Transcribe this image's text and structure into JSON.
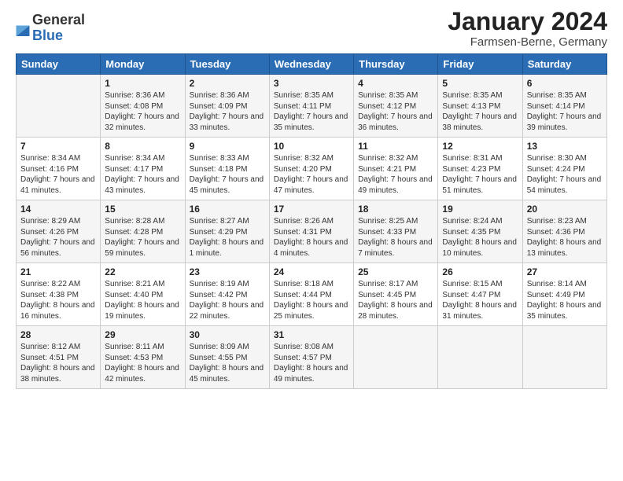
{
  "header": {
    "logo": {
      "general": "General",
      "blue": "Blue"
    },
    "title": "January 2024",
    "subtitle": "Farmsen-Berne, Germany"
  },
  "days_of_week": [
    "Sunday",
    "Monday",
    "Tuesday",
    "Wednesday",
    "Thursday",
    "Friday",
    "Saturday"
  ],
  "weeks": [
    [
      {
        "day": "",
        "sunrise": "",
        "sunset": "",
        "daylight": ""
      },
      {
        "day": "1",
        "sunrise": "Sunrise: 8:36 AM",
        "sunset": "Sunset: 4:08 PM",
        "daylight": "Daylight: 7 hours and 32 minutes."
      },
      {
        "day": "2",
        "sunrise": "Sunrise: 8:36 AM",
        "sunset": "Sunset: 4:09 PM",
        "daylight": "Daylight: 7 hours and 33 minutes."
      },
      {
        "day": "3",
        "sunrise": "Sunrise: 8:35 AM",
        "sunset": "Sunset: 4:11 PM",
        "daylight": "Daylight: 7 hours and 35 minutes."
      },
      {
        "day": "4",
        "sunrise": "Sunrise: 8:35 AM",
        "sunset": "Sunset: 4:12 PM",
        "daylight": "Daylight: 7 hours and 36 minutes."
      },
      {
        "day": "5",
        "sunrise": "Sunrise: 8:35 AM",
        "sunset": "Sunset: 4:13 PM",
        "daylight": "Daylight: 7 hours and 38 minutes."
      },
      {
        "day": "6",
        "sunrise": "Sunrise: 8:35 AM",
        "sunset": "Sunset: 4:14 PM",
        "daylight": "Daylight: 7 hours and 39 minutes."
      }
    ],
    [
      {
        "day": "7",
        "sunrise": "Sunrise: 8:34 AM",
        "sunset": "Sunset: 4:16 PM",
        "daylight": "Daylight: 7 hours and 41 minutes."
      },
      {
        "day": "8",
        "sunrise": "Sunrise: 8:34 AM",
        "sunset": "Sunset: 4:17 PM",
        "daylight": "Daylight: 7 hours and 43 minutes."
      },
      {
        "day": "9",
        "sunrise": "Sunrise: 8:33 AM",
        "sunset": "Sunset: 4:18 PM",
        "daylight": "Daylight: 7 hours and 45 minutes."
      },
      {
        "day": "10",
        "sunrise": "Sunrise: 8:32 AM",
        "sunset": "Sunset: 4:20 PM",
        "daylight": "Daylight: 7 hours and 47 minutes."
      },
      {
        "day": "11",
        "sunrise": "Sunrise: 8:32 AM",
        "sunset": "Sunset: 4:21 PM",
        "daylight": "Daylight: 7 hours and 49 minutes."
      },
      {
        "day": "12",
        "sunrise": "Sunrise: 8:31 AM",
        "sunset": "Sunset: 4:23 PM",
        "daylight": "Daylight: 7 hours and 51 minutes."
      },
      {
        "day": "13",
        "sunrise": "Sunrise: 8:30 AM",
        "sunset": "Sunset: 4:24 PM",
        "daylight": "Daylight: 7 hours and 54 minutes."
      }
    ],
    [
      {
        "day": "14",
        "sunrise": "Sunrise: 8:29 AM",
        "sunset": "Sunset: 4:26 PM",
        "daylight": "Daylight: 7 hours and 56 minutes."
      },
      {
        "day": "15",
        "sunrise": "Sunrise: 8:28 AM",
        "sunset": "Sunset: 4:28 PM",
        "daylight": "Daylight: 7 hours and 59 minutes."
      },
      {
        "day": "16",
        "sunrise": "Sunrise: 8:27 AM",
        "sunset": "Sunset: 4:29 PM",
        "daylight": "Daylight: 8 hours and 1 minute."
      },
      {
        "day": "17",
        "sunrise": "Sunrise: 8:26 AM",
        "sunset": "Sunset: 4:31 PM",
        "daylight": "Daylight: 8 hours and 4 minutes."
      },
      {
        "day": "18",
        "sunrise": "Sunrise: 8:25 AM",
        "sunset": "Sunset: 4:33 PM",
        "daylight": "Daylight: 8 hours and 7 minutes."
      },
      {
        "day": "19",
        "sunrise": "Sunrise: 8:24 AM",
        "sunset": "Sunset: 4:35 PM",
        "daylight": "Daylight: 8 hours and 10 minutes."
      },
      {
        "day": "20",
        "sunrise": "Sunrise: 8:23 AM",
        "sunset": "Sunset: 4:36 PM",
        "daylight": "Daylight: 8 hours and 13 minutes."
      }
    ],
    [
      {
        "day": "21",
        "sunrise": "Sunrise: 8:22 AM",
        "sunset": "Sunset: 4:38 PM",
        "daylight": "Daylight: 8 hours and 16 minutes."
      },
      {
        "day": "22",
        "sunrise": "Sunrise: 8:21 AM",
        "sunset": "Sunset: 4:40 PM",
        "daylight": "Daylight: 8 hours and 19 minutes."
      },
      {
        "day": "23",
        "sunrise": "Sunrise: 8:19 AM",
        "sunset": "Sunset: 4:42 PM",
        "daylight": "Daylight: 8 hours and 22 minutes."
      },
      {
        "day": "24",
        "sunrise": "Sunrise: 8:18 AM",
        "sunset": "Sunset: 4:44 PM",
        "daylight": "Daylight: 8 hours and 25 minutes."
      },
      {
        "day": "25",
        "sunrise": "Sunrise: 8:17 AM",
        "sunset": "Sunset: 4:45 PM",
        "daylight": "Daylight: 8 hours and 28 minutes."
      },
      {
        "day": "26",
        "sunrise": "Sunrise: 8:15 AM",
        "sunset": "Sunset: 4:47 PM",
        "daylight": "Daylight: 8 hours and 31 minutes."
      },
      {
        "day": "27",
        "sunrise": "Sunrise: 8:14 AM",
        "sunset": "Sunset: 4:49 PM",
        "daylight": "Daylight: 8 hours and 35 minutes."
      }
    ],
    [
      {
        "day": "28",
        "sunrise": "Sunrise: 8:12 AM",
        "sunset": "Sunset: 4:51 PM",
        "daylight": "Daylight: 8 hours and 38 minutes."
      },
      {
        "day": "29",
        "sunrise": "Sunrise: 8:11 AM",
        "sunset": "Sunset: 4:53 PM",
        "daylight": "Daylight: 8 hours and 42 minutes."
      },
      {
        "day": "30",
        "sunrise": "Sunrise: 8:09 AM",
        "sunset": "Sunset: 4:55 PM",
        "daylight": "Daylight: 8 hours and 45 minutes."
      },
      {
        "day": "31",
        "sunrise": "Sunrise: 8:08 AM",
        "sunset": "Sunset: 4:57 PM",
        "daylight": "Daylight: 8 hours and 49 minutes."
      },
      {
        "day": "",
        "sunrise": "",
        "sunset": "",
        "daylight": ""
      },
      {
        "day": "",
        "sunrise": "",
        "sunset": "",
        "daylight": ""
      },
      {
        "day": "",
        "sunrise": "",
        "sunset": "",
        "daylight": ""
      }
    ]
  ]
}
